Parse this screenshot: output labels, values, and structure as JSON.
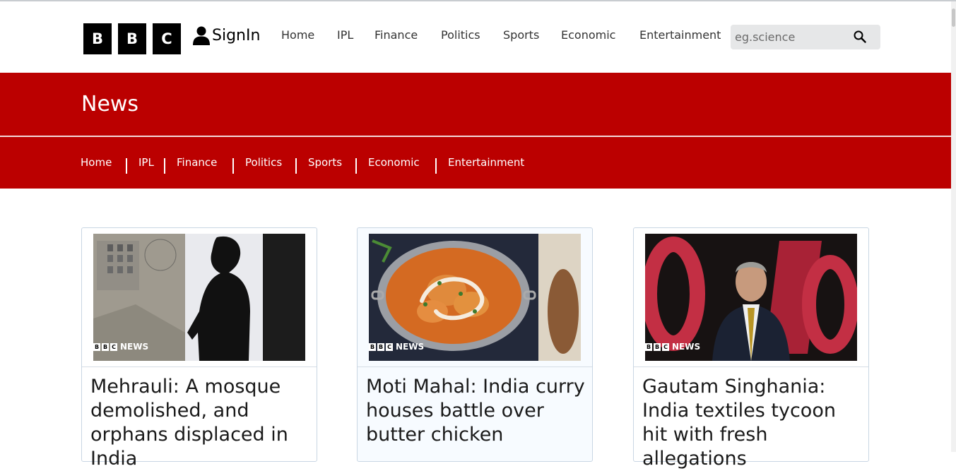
{
  "logo": {
    "letters": [
      "B",
      "B",
      "C"
    ]
  },
  "signin": {
    "label": "SignIn",
    "icon": "user-icon"
  },
  "top_nav": [
    "Home",
    "IPL",
    "Finance",
    "Politics",
    "Sports",
    "Economic",
    "Entertainment"
  ],
  "search": {
    "placeholder": "eg.science",
    "icon": "search-icon"
  },
  "section": {
    "title": "News"
  },
  "sub_nav": [
    "Home",
    "IPL",
    "Finance",
    "Politics",
    "Sports",
    "Economic",
    "Entertainment"
  ],
  "badge": {
    "letters": [
      "B",
      "B",
      "C"
    ],
    "label": "NEWS"
  },
  "cards": [
    {
      "headline": "Mehrauli: A mosque demolished, and orphans displaced in India",
      "image": "silhouette-photo"
    },
    {
      "headline": "Moti Mahal: India curry houses battle over butter chicken",
      "image": "butter-chicken-photo"
    },
    {
      "headline": "Gautam Singhania: India textiles tycoon hit with fresh allegations",
      "image": "singhania-photo"
    }
  ],
  "colors": {
    "brand_red": "#bb0000",
    "logo_black": "#000000",
    "card_border": "#c9d6e3"
  }
}
